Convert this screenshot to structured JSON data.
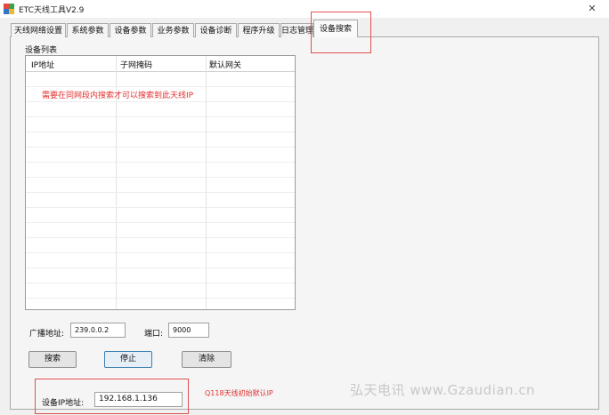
{
  "window": {
    "title": "ETC天线工具V2.9",
    "close_glyph": "✕"
  },
  "tabs": [
    {
      "label": "天线网络设置"
    },
    {
      "label": "系统参数"
    },
    {
      "label": "设备参数"
    },
    {
      "label": "业务参数"
    },
    {
      "label": "设备诊断"
    },
    {
      "label": "程序升级"
    },
    {
      "label": "日志管理"
    },
    {
      "label": "设备搜索",
      "active": true
    }
  ],
  "device_list": {
    "group_label": "设备列表",
    "columns": [
      "IP地址",
      "子网掩码",
      "默认网关"
    ],
    "rows": [],
    "note": "需要在同网段内搜索才可以搜索到此天线IP"
  },
  "broadcast": {
    "label": "广播地址:",
    "value": "239.0.0.2"
  },
  "port": {
    "label": "端口:",
    "value": "9000"
  },
  "buttons": {
    "search": "搜索",
    "stop": "停止",
    "clear": "清除"
  },
  "device_ip": {
    "label": "设备IP地址:",
    "value": "192.168.1.136",
    "note": "Q118天线初始默认IP"
  },
  "watermark": "弘天电讯  www.Gzaudian.cn",
  "colors": {
    "highlight_red": "#e05050",
    "note_red": "#e03030",
    "focus_blue": "#3c7fb1"
  },
  "icons": {
    "app": "app-logo-icon",
    "close": "close-icon"
  }
}
